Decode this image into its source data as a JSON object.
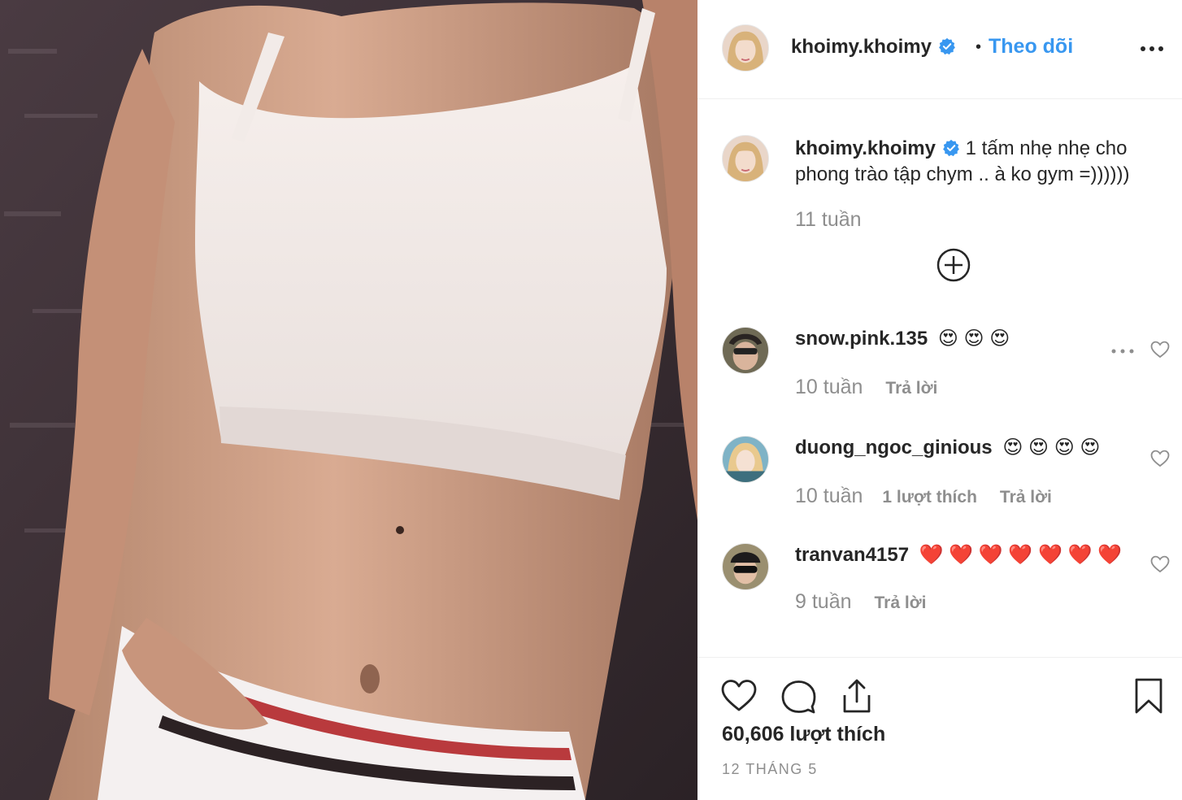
{
  "post": {
    "author": {
      "username": "khoimy.khoimy",
      "verified": true,
      "follow_label": "Theo dõi"
    },
    "caption": {
      "username": "khoimy.khoimy",
      "text": "1 tấm nhẹ nhẹ cho phong trào tập chym .. à ko gym =))))))",
      "time": "11 tuần"
    },
    "comments": [
      {
        "username": "snow.pink.135",
        "emojis": "😍 😍 😍",
        "time": "10 tuần",
        "likes_label": "",
        "reply_label": "Trả lời"
      },
      {
        "username": "duong_ngoc_ginious",
        "emojis": "😍 😍 😍 😍",
        "time": "10 tuần",
        "likes_label": "1 lượt thích",
        "reply_label": "Trả lời"
      },
      {
        "username": "tranvan4157",
        "emojis": "❤️ ❤️ ❤️ ❤️ ❤️ ❤️ ❤️",
        "time": "9 tuần",
        "likes_label": "",
        "reply_label": "Trả lời"
      }
    ],
    "likes": "60,606 lượt thích",
    "date": "12 THÁNG 5"
  },
  "colors": {
    "accent": "#3897f0",
    "text": "#262626",
    "muted": "#8e8e8e",
    "divider": "#efefef"
  },
  "icons": {
    "header": [
      "verified-badge-icon",
      "more-options-icon"
    ],
    "actions": [
      "heart-icon",
      "comment-icon",
      "share-icon",
      "bookmark-icon"
    ],
    "other": [
      "load-more-comments-icon",
      "comment-heart-icon"
    ]
  }
}
